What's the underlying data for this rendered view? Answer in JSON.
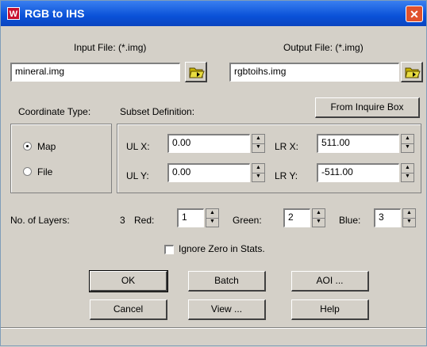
{
  "window": {
    "title": "RGB to IHS",
    "close_glyph": "✕",
    "app_icon": "W"
  },
  "input_file": {
    "label": "Input File: (*.img)",
    "value": "mineral.img"
  },
  "output_file": {
    "label": "Output File: (*.img)",
    "value": "rgbtoihs.img"
  },
  "coordinate": {
    "label": "Coordinate Type:",
    "options": [
      "Map",
      "File"
    ],
    "selected": "Map"
  },
  "subset": {
    "label": "Subset Definition:",
    "from_inquire_label": "From Inquire Box",
    "ulx_label": "UL X:",
    "ulx": "0.00",
    "uly_label": "UL Y:",
    "uly": "0.00",
    "lrx_label": "LR X:",
    "lrx": "511.00",
    "lry_label": "LR Y:",
    "lry": "-511.00"
  },
  "layers": {
    "label": "No. of Layers:",
    "count": "3",
    "red_label": "Red:",
    "red": "1",
    "green_label": "Green:",
    "green": "2",
    "blue_label": "Blue:",
    "blue": "3"
  },
  "ignore_zero": {
    "label": "Ignore Zero in Stats.",
    "checked": false
  },
  "buttons": {
    "ok": "OK",
    "batch": "Batch",
    "aoi": "AOI ...",
    "cancel": "Cancel",
    "view": "View ...",
    "help": "Help"
  },
  "icons": {
    "folder": "folder-open-icon",
    "spin_up": "▲",
    "spin_down": "▼"
  },
  "colors": {
    "titlebar": "#0a52d8",
    "dialog": "#d4d0c8",
    "close": "#e0522c"
  }
}
